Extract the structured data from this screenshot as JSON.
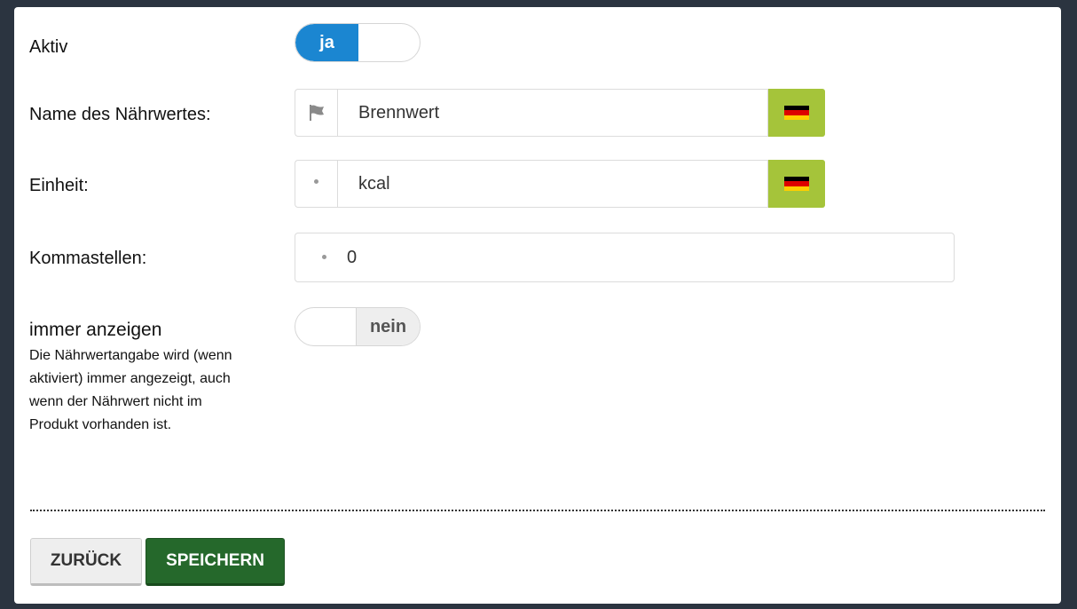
{
  "form": {
    "active": {
      "label": "Aktiv",
      "state_label": "ja",
      "value": true
    },
    "name": {
      "label": "Name des Nährwertes:",
      "value": "Brennwert",
      "addon_icon": "flag-icon",
      "language": "de"
    },
    "unit": {
      "label": "Einheit:",
      "value": "kcal",
      "addon_icon": "dot-icon",
      "language": "de"
    },
    "decimals": {
      "label": "Kommastellen:",
      "value": "0",
      "addon_icon": "dot-icon"
    },
    "always_show": {
      "label": "immer anzeigen",
      "help": "Die Nährwertangabe wird (wenn aktiviert) immer angezeigt, auch wenn der Nährwert nicht im Produkt vorhanden ist.",
      "state_label": "nein",
      "value": false
    }
  },
  "buttons": {
    "back": "ZURÜCK",
    "save": "SPEICHERN"
  },
  "colors": {
    "toggle_on": "#1b86d1",
    "flag_button": "#a5c43a",
    "save_button": "#25682b",
    "flag_de": [
      "#000000",
      "#dd0000",
      "#ffce00"
    ]
  }
}
